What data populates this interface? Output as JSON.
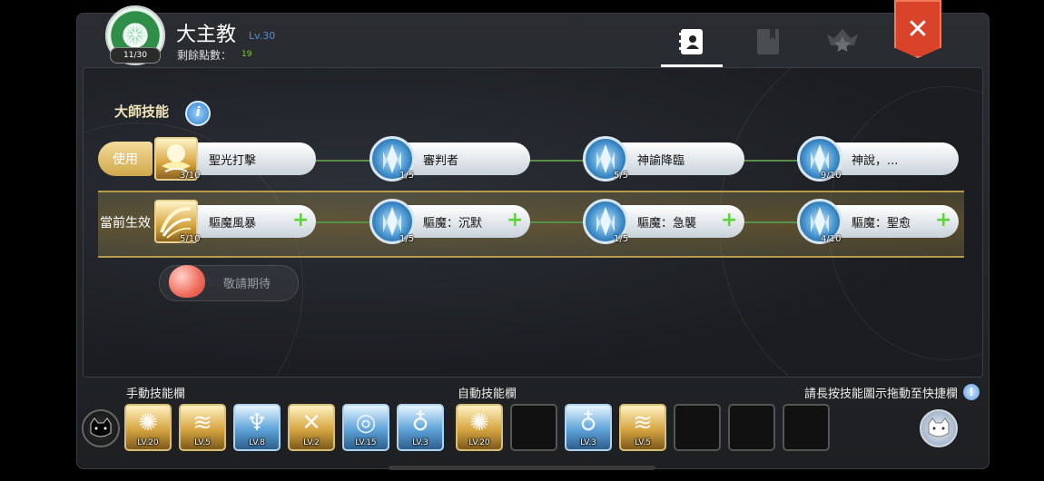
{
  "header": {
    "class_name": "大主教",
    "class_level": "Lv.30",
    "emblem_badge": "11/30",
    "points_label": "剩餘點數：",
    "points_value": "19",
    "tabs": [
      {
        "icon": "profile-book-icon",
        "active": true
      },
      {
        "icon": "closed-book-icon",
        "active": false
      },
      {
        "icon": "star-emblem-icon",
        "active": false
      }
    ],
    "close_icon": "close-icon",
    "accent_color": "#d8432a"
  },
  "master_skills": {
    "title": "大師技能",
    "info_label": "i",
    "use_label": "使用",
    "current_label": "當前生效",
    "use_row": [
      {
        "name": "聖光打擊",
        "level": "3/10",
        "icon": "holy-light-icon",
        "style": "gold"
      },
      {
        "name": "審判者",
        "level": "1/5",
        "icon": "blue-crystal-icon",
        "style": "blue"
      },
      {
        "name": "神諭降臨",
        "level": "5/5",
        "icon": "blue-crystal-icon",
        "style": "blue"
      },
      {
        "name": "神說，...",
        "level": "9/10",
        "icon": "blue-crystal-icon",
        "style": "blue"
      }
    ],
    "active_row": [
      {
        "name": "驅魔風暴",
        "level": "5/10",
        "icon": "exorcism-storm-icon",
        "style": "gold",
        "plus": "+"
      },
      {
        "name": "驅魔：沉默",
        "level": "1/5",
        "icon": "blue-crystal-icon",
        "style": "blue",
        "plus": "+"
      },
      {
        "name": "驅魔：急襲",
        "level": "1/5",
        "icon": "blue-crystal-icon",
        "style": "blue",
        "plus": "+"
      },
      {
        "name": "驅魔：聖愈",
        "level": "4/10",
        "icon": "blue-crystal-icon",
        "style": "blue",
        "plus": "+"
      }
    ],
    "coming_soon": "敬請期待"
  },
  "skill_bar": {
    "manual_label": "手動技能欄",
    "auto_label": "自動技能欄",
    "hint": "請長按技能圖示拖動至快捷欄",
    "hint_icon": "info-icon",
    "manual_slots": [
      {
        "lv": "LV.20",
        "style": "gold",
        "glyph": "✺"
      },
      {
        "lv": "LV.5",
        "style": "gold",
        "glyph": "≋"
      },
      {
        "lv": "LV.8",
        "style": "blue",
        "glyph": "♆"
      },
      {
        "lv": "LV.2",
        "style": "gold",
        "glyph": "✕"
      },
      {
        "lv": "LV.15",
        "style": "blue",
        "glyph": "◎"
      },
      {
        "lv": "LV.3",
        "style": "blue",
        "glyph": "♁"
      }
    ],
    "auto_slots": [
      {
        "lv": "LV.20",
        "style": "gold",
        "glyph": "✺"
      },
      {
        "lv": "",
        "style": "empty",
        "glyph": ""
      },
      {
        "lv": "LV.3",
        "style": "blue",
        "glyph": "♁"
      },
      {
        "lv": "LV.5",
        "style": "gold",
        "glyph": "≋"
      },
      {
        "lv": "",
        "style": "empty",
        "glyph": ""
      },
      {
        "lv": "",
        "style": "empty",
        "glyph": ""
      },
      {
        "lv": "",
        "style": "empty",
        "glyph": ""
      }
    ],
    "left_button_icon": "black-cat-face-icon",
    "right_button_icon": "white-cat-face-icon"
  }
}
